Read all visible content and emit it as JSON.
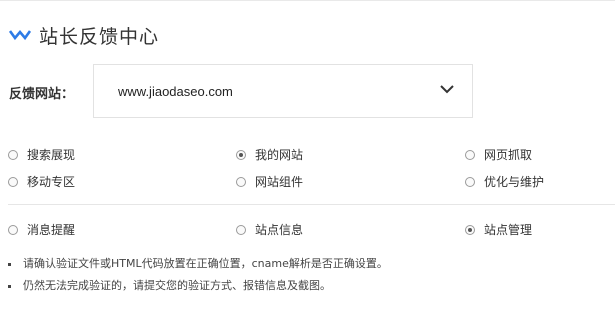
{
  "header": {
    "title": "站长反馈中心",
    "icon": "check-chevron-icon",
    "accent": "#2d7be6"
  },
  "site_select": {
    "label": "反馈网站：",
    "value": "www.jiaodaseo.com"
  },
  "options_group1": [
    {
      "label": "搜索展现",
      "checked": false
    },
    {
      "label": "我的网站",
      "checked": true
    },
    {
      "label": "网页抓取",
      "checked": false
    },
    {
      "label": "移动专区",
      "checked": false
    },
    {
      "label": "网站组件",
      "checked": false
    },
    {
      "label": "优化与维护",
      "checked": false
    }
  ],
  "options_group2": [
    {
      "label": "消息提醒",
      "checked": false
    },
    {
      "label": "站点信息",
      "checked": false
    },
    {
      "label": "站点管理",
      "checked": true
    }
  ],
  "notes": [
    "请确认验证文件或HTML代码放置在正确位置，cname解析是否正确设置。",
    "仍然无法完成验证的，请提交您的验证方式、报错信息及截图。"
  ]
}
